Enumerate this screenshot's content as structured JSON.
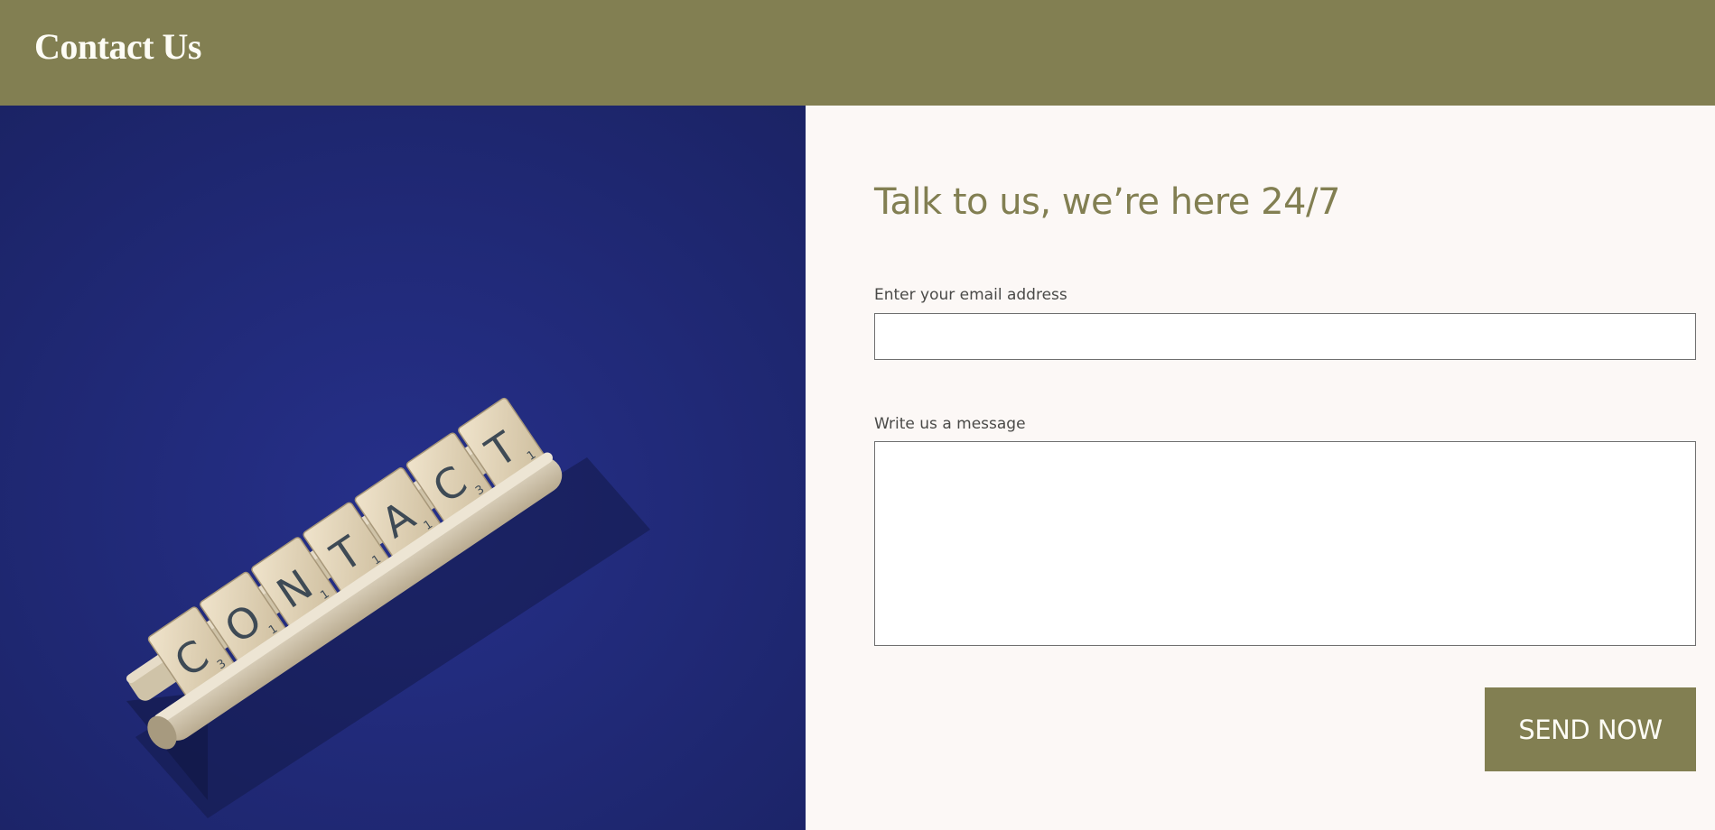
{
  "header": {
    "title": "Contact Us"
  },
  "hero": {
    "tiles": [
      {
        "letter": "C",
        "score": "3"
      },
      {
        "letter": "O",
        "score": "1"
      },
      {
        "letter": "N",
        "score": "1"
      },
      {
        "letter": "T",
        "score": "1"
      },
      {
        "letter": "A",
        "score": "1"
      },
      {
        "letter": "C",
        "score": "3"
      },
      {
        "letter": "T",
        "score": "1"
      }
    ]
  },
  "form": {
    "heading": "Talk to us, we’re here 24/7",
    "email_label": "Enter your email address",
    "email_value": "",
    "message_label": "Write us a message",
    "message_value": "",
    "send_label": "SEND NOW"
  },
  "colors": {
    "brand_olive": "#827f52",
    "page_background": "#fcf8f6",
    "hero_background": "#1f2870"
  }
}
